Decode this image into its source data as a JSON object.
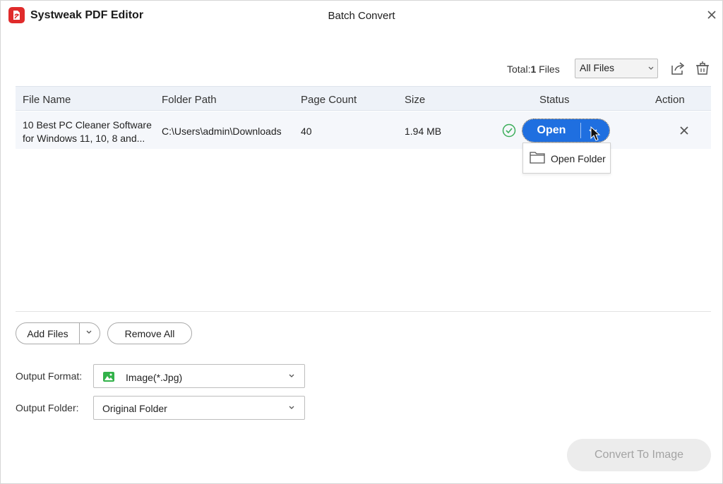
{
  "titlebar": {
    "app_name": "Systweak PDF Editor",
    "window_title": "Batch Convert"
  },
  "toolbar": {
    "total_label": "Total:",
    "total_count": "1",
    "total_unit": "Files",
    "filter_value": "All Files",
    "icons": [
      "export-icon",
      "clean-trash-icon"
    ]
  },
  "table": {
    "headers": {
      "file_name": "File Name",
      "folder_path": "Folder Path",
      "page_count": "Page Count",
      "size": "Size",
      "status": "Status",
      "action": "Action"
    },
    "rows": [
      {
        "file_name_line1": "10 Best PC Cleaner Software",
        "file_name_line2": "for Windows 11, 10, 8 and...",
        "folder_path": "C:\\Users\\admin\\Downloads",
        "page_count": "40",
        "size": "1.94 MB",
        "status": "success",
        "open_label": "Open"
      }
    ]
  },
  "dropdown_menu": {
    "open_folder_label": "Open Folder"
  },
  "bottom": {
    "add_files_label": "Add Files",
    "remove_all_label": "Remove All",
    "output_format_label": "Output Format:",
    "output_format_value": "Image(*.Jpg)",
    "output_folder_label": "Output Folder:",
    "output_folder_value": "Original Folder",
    "convert_label": "Convert To Image"
  },
  "colors": {
    "accent": "#1f6fe0",
    "success": "#3cae5a",
    "brand_red": "#e02b2b",
    "disabled_bg": "#ececec",
    "disabled_text": "#a3a3a3"
  }
}
